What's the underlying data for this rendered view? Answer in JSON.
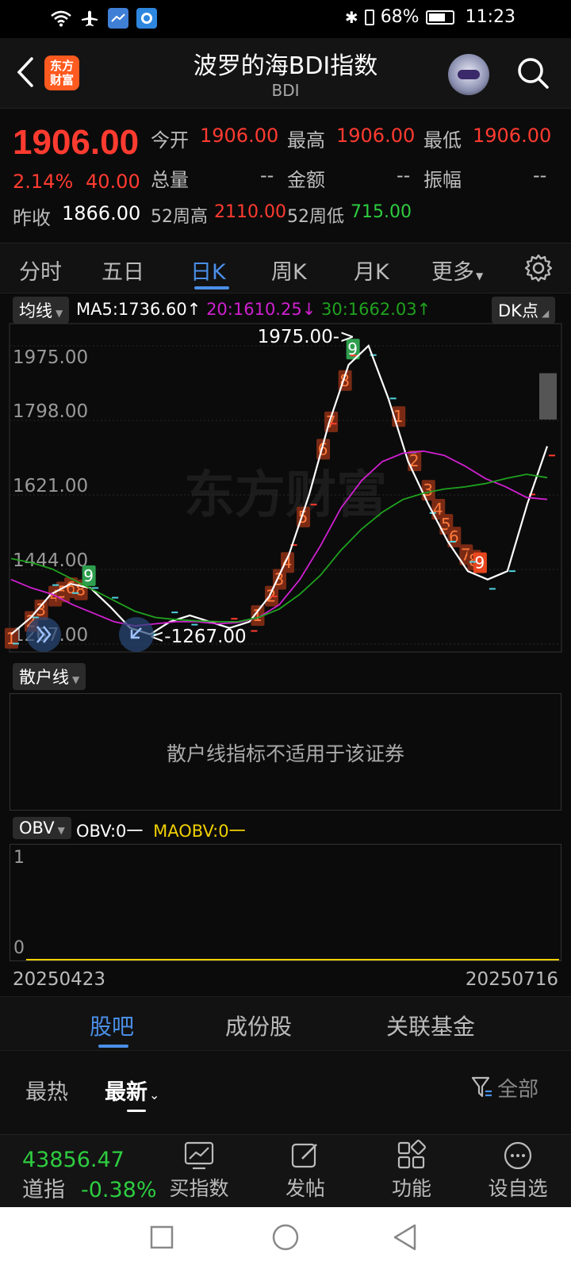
{
  "status_bar": {
    "battery": "68%",
    "time": "11:23"
  },
  "header": {
    "logo_line1": "东方",
    "logo_line2": "财富",
    "title": "波罗的海BDI指数",
    "subtitle": "BDI"
  },
  "quote": {
    "price": "1906.00",
    "change_pct": "2.14%",
    "change_abs": "40.00",
    "prev_close_label": "昨收",
    "prev_close": "1866.00",
    "open_label": "今开",
    "open": "1906.00",
    "high_label": "最高",
    "high": "1906.00",
    "low_label": "最低",
    "low": "1906.00",
    "volume_label": "总量",
    "volume": "--",
    "amount_label": "金额",
    "amount": "--",
    "amplitude_label": "振幅",
    "amplitude": "--",
    "w52_high_label": "52周高",
    "w52_high": "2110.00",
    "w52_low_label": "52周低",
    "w52_low": "715.00"
  },
  "tabs": [
    "分时",
    "五日",
    "日K",
    "周K",
    "月K",
    "更多"
  ],
  "chart": {
    "ma_selector": "均线",
    "ma5": "MA5:1736.60",
    "ma20": "20:1610.25",
    "ma30": "30:1662.03",
    "dk_button": "DK点",
    "y_ticks": [
      "1975.00",
      "1798.00",
      "1621.00",
      "1444.00",
      "1267.00"
    ],
    "max_marker": "1975.00->",
    "min_marker": "<-1267.00",
    "watermark": "东方财富",
    "retail_selector": "散户线",
    "retail_na": "散户线指标不适用于该证券",
    "obv_selector": "OBV",
    "obv_label": "OBV:0",
    "maobv_label": "MAOBV:0",
    "obv_top": "1",
    "obv_bottom": "0",
    "date_start": "20250423",
    "date_end": "20250716"
  },
  "chart_data": {
    "type": "line",
    "x_range": [
      "20250423",
      "20250716"
    ],
    "ylim": [
      1267,
      1975
    ],
    "series": [
      {
        "name": "MA5",
        "values": [
          1290,
          1330,
          1385,
          1410,
          1400,
          1355,
          1305,
          1290,
          1320,
          1335,
          1320,
          1305,
          1320,
          1380,
          1480,
          1620,
          1790,
          1930,
          1975,
          1850,
          1700,
          1600,
          1510,
          1440,
          1420,
          1440,
          1600,
          1736.6
        ]
      },
      {
        "name": "20",
        "values": [
          1420,
          1400,
          1385,
          1360,
          1340,
          1320,
          1310,
          1315,
          1320,
          1320,
          1315,
          1318,
          1330,
          1360,
          1420,
          1500,
          1590,
          1655,
          1700,
          1720,
          1725,
          1715,
          1690,
          1660,
          1640,
          1615,
          1610.25
        ]
      },
      {
        "name": "30",
        "values": [
          1470,
          1460,
          1445,
          1420,
          1395,
          1370,
          1345,
          1330,
          1325,
          1322,
          1320,
          1320,
          1330,
          1350,
          1385,
          1430,
          1490,
          1540,
          1580,
          1610,
          1625,
          1635,
          1640,
          1648,
          1660,
          1670,
          1662.03
        ]
      }
    ],
    "annotations": [
      {
        "text": "1975.00->",
        "y": 1975
      },
      {
        "text": "<-1267.00",
        "y": 1267
      }
    ]
  },
  "bottom_tabs": [
    "股吧",
    "成份股",
    "关联基金"
  ],
  "sub_tabs": {
    "hot": "最热",
    "latest": "最新",
    "filter": "全部"
  },
  "toolbar": {
    "dow_value": "43856.47",
    "dow_label": "道指",
    "dow_change": "-0.38%",
    "buy_index": "买指数",
    "post": "发帖",
    "function": "功能",
    "add_watch": "设自选"
  },
  "colors": {
    "red": "#ff3b30",
    "green": "#2ecc40",
    "blue": "#4a8fe7",
    "ma5": "#ffffff",
    "ma20": "#d020d0",
    "ma30": "#1fa21f",
    "maobv": "#f0d000"
  }
}
